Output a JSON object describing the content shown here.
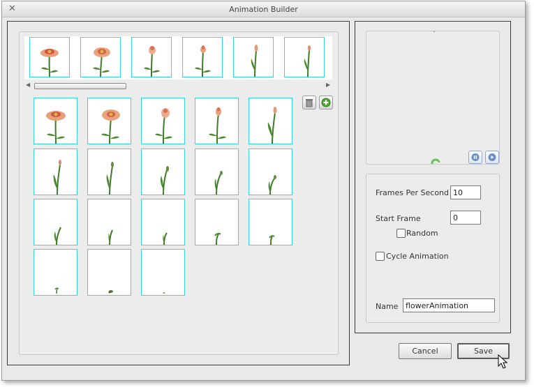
{
  "window": {
    "title": "Animation Builder"
  },
  "preview": {
    "pause_icon": "pause-icon",
    "play_icon": "play-icon"
  },
  "settings": {
    "fps_label": "Frames Per Second",
    "fps_value": "10",
    "start_frame_label": "Start Frame",
    "start_frame_value": "0",
    "random_label": "Random",
    "random_checked": false,
    "cycle_label": "Cycle Animation",
    "cycle_checked": false,
    "name_label": "Name",
    "name_value": "flowerAnimation"
  },
  "buttons": {
    "cancel": "Cancel",
    "save": "Save"
  },
  "toolbar": {
    "delete_icon": "trash-icon",
    "add_icon": "add-icon"
  },
  "colors": {
    "frame_border": "#37d6db",
    "panel_bg": "#ececec",
    "window_bg": "#e9e9e9"
  }
}
